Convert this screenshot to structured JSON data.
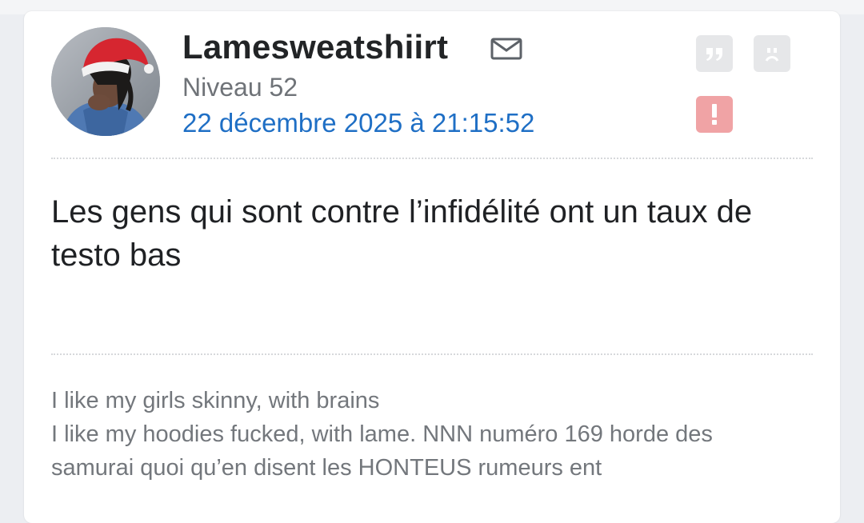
{
  "post": {
    "username": "Lamesweatshiirt",
    "level": "Niveau 52",
    "date": "22 décembre 2025 à 21:15:52",
    "message": "Les gens qui sont contre l’infidélité ont un taux de testo bas",
    "signature": {
      "lines": [
        "I like my girls skinny, with brains",
        "I like my hoodies fucked, with lame. NNN numéro 169 horde des",
        "samurai quoi qu’en disent les HONTEUS rumeurs ent"
      ]
    }
  },
  "icons": {
    "mail": "envelope-icon",
    "quote": "quote-icon",
    "sad": "sad-face-icon",
    "alert": "exclamation-icon"
  },
  "colors": {
    "date_link": "#1f6fc5",
    "alert_button": "#f0a3a5",
    "action_button": "#e6e7e9"
  }
}
